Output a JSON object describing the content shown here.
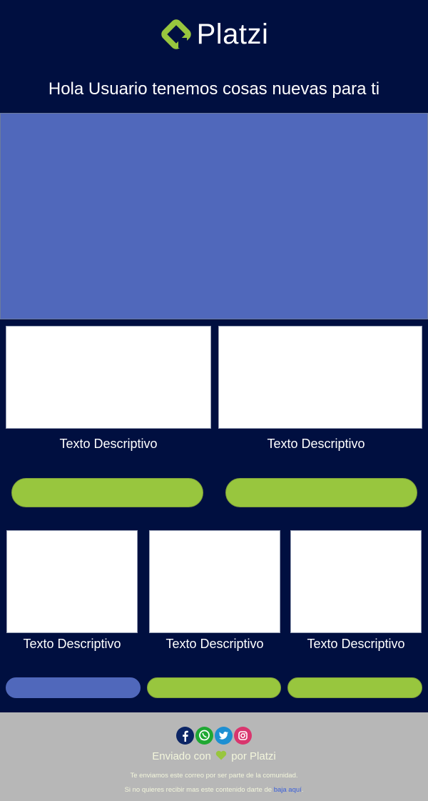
{
  "header": {
    "brand_name": "Platzi",
    "greeting": "Hola Usuario tenemos cosas nuevas para ti"
  },
  "row1": {
    "cards": [
      {
        "caption": "Texto Descriptivo"
      },
      {
        "caption": "Texto Descriptivo"
      }
    ]
  },
  "row2": {
    "cards": [
      {
        "caption": "Texto Descriptivo"
      },
      {
        "caption": "Texto Descriptivo"
      },
      {
        "caption": "Texto Descriptivo"
      }
    ]
  },
  "footer": {
    "social_icons": [
      "facebook-icon",
      "whatsapp-icon",
      "twitter-icon",
      "instagram-icon"
    ],
    "sent_prefix": "Enviado con",
    "sent_suffix": "por Platzi",
    "note": "Te enviamos este correo por ser parte de la comunidad.",
    "unsubscribe_prefix": "Si no quieres recibir mas este contenido darte de",
    "unsubscribe_link": "baja aquí",
    "unsubscribe_end": "."
  },
  "colors": {
    "background": "#000f40",
    "hero": "#5068bb",
    "accent_green": "#98c63e",
    "footer": "#b7b7b7"
  }
}
